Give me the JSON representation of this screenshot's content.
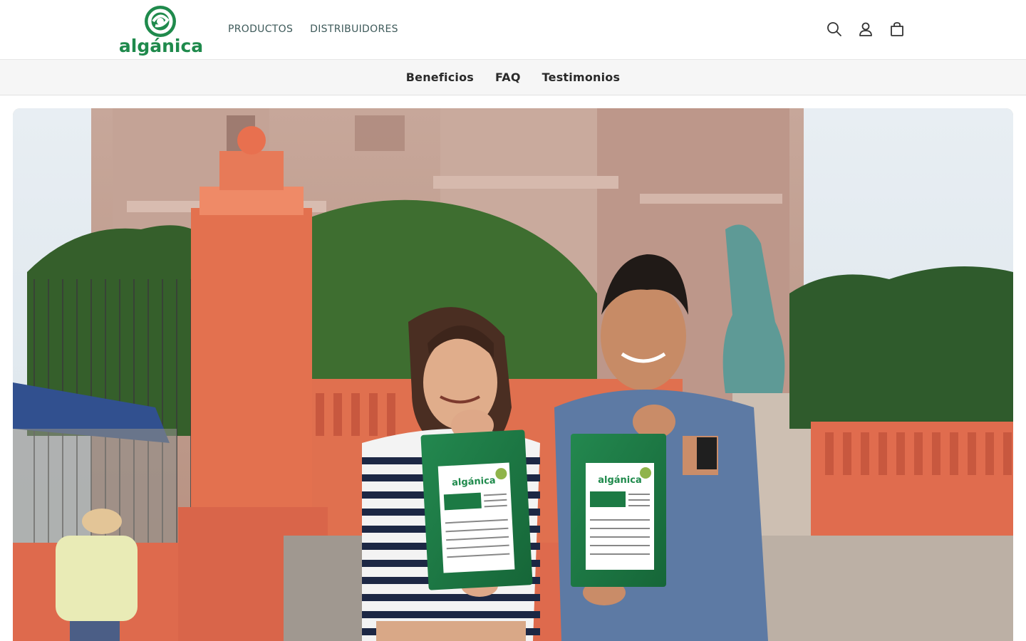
{
  "brand": {
    "logo_text": "algánica",
    "color": "#1f8a4c"
  },
  "nav": {
    "items": [
      {
        "label": "PRODUCTOS"
      },
      {
        "label": "DISTRIBUIDORES"
      }
    ]
  },
  "header_icons": [
    "search-icon",
    "account-icon",
    "cart-icon"
  ],
  "subnav": {
    "items": [
      {
        "label": "Beneficios"
      },
      {
        "label": "FAQ"
      },
      {
        "label": "Testimonios"
      }
    ]
  },
  "hero": {
    "image_subject": "Two people holding green algánica product bags in front of a church",
    "package_brand": "algánica"
  },
  "colors": {
    "nav_text": "#3e5a5a",
    "subnav_bg": "#f6f6f6",
    "package_green": "#1c7a44"
  }
}
